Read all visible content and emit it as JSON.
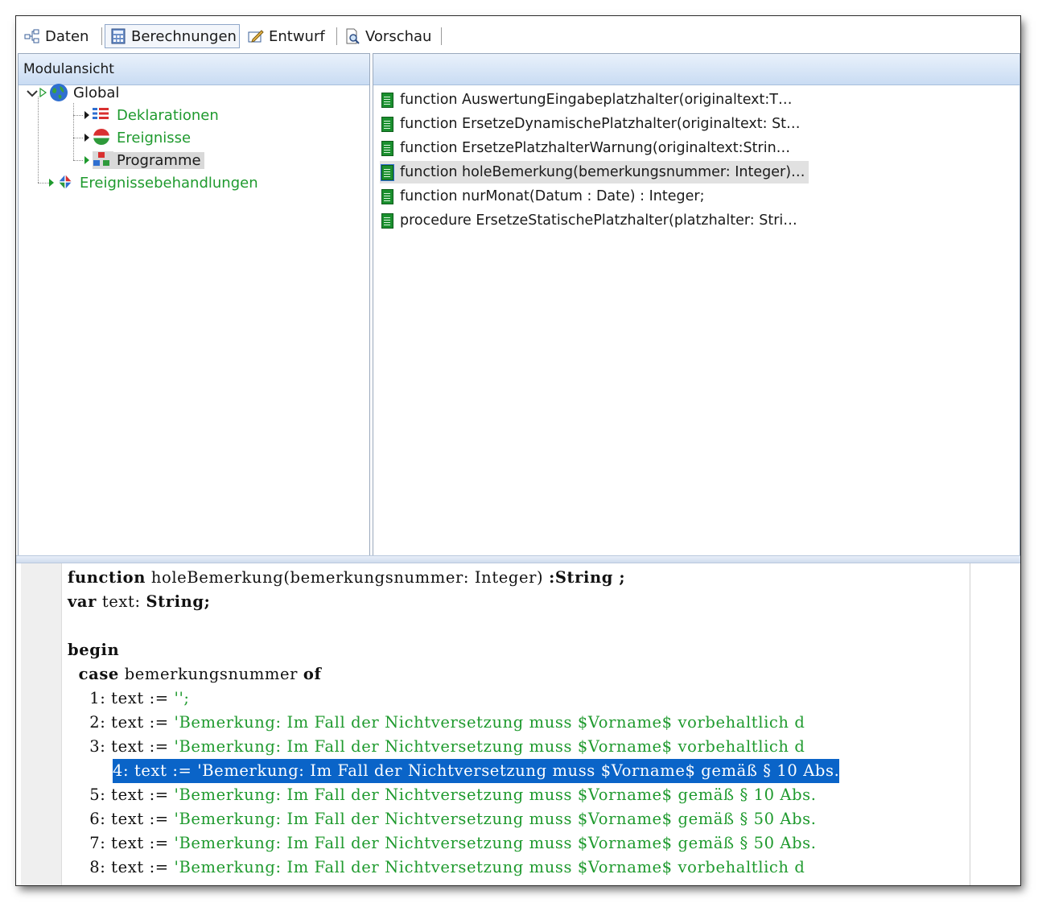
{
  "tabs": [
    {
      "label": "Daten",
      "icon": "data-structure-icon"
    },
    {
      "label": "Berechnungen",
      "icon": "calculator-icon",
      "active": true
    },
    {
      "label": "Entwurf",
      "icon": "edit-pencil-icon"
    },
    {
      "label": "Vorschau",
      "icon": "preview-magnifier-icon"
    }
  ],
  "left_pane": {
    "header": "Modulansicht",
    "tree": {
      "root": {
        "label": "Global",
        "icon": "globe-icon",
        "expanded": true
      },
      "children": [
        {
          "label": "Deklarationen",
          "icon": "declarations-icon"
        },
        {
          "label": "Ereignisse",
          "icon": "events-icon"
        },
        {
          "label": "Programme",
          "icon": "programs-icon",
          "selected": true
        }
      ],
      "sibling": {
        "label": "Ereignissebehandlungen",
        "icon": "event-handlers-icon"
      }
    }
  },
  "right_pane": {
    "header": "",
    "functions": [
      "function AuswertungEingabeplatzhalter(originaltext:T…",
      "function ErsetzeDynamischePlatzhalter(originaltext: St…",
      "function ErsetzePlatzhalterWarnung(originaltext:Strin…",
      "function holeBemerkung(bemerkungsnummer: Integer)…",
      "function nurMonat(Datum : Date) : Integer;",
      "procedure ErsetzeStatischePlatzhalter(platzhalter: Stri…"
    ],
    "selected_index": 3
  },
  "editor": {
    "line1": {
      "kw": "function",
      "rest": " holeBemerkung(bemerkungsnummer: Integer) ",
      "kw2": ":String ;"
    },
    "line2": {
      "kw": "var",
      "rest": " text: ",
      "kw2": "String;"
    },
    "line4": {
      "kw": "begin"
    },
    "line5": {
      "indent": "  ",
      "kw": "case",
      "rest": " bemerkungsnummer ",
      "kw2": "of"
    },
    "case_lines": [
      {
        "prefix": "    1: text := ",
        "str": "'';",
        "highlighted": false
      },
      {
        "prefix": "    2: text := ",
        "str": "'Bemerkung: Im Fall der Nichtversetzung muss $Vorname$ vorbehaltlich d",
        "highlighted": false
      },
      {
        "prefix": "    3: text := ",
        "str": "'Bemerkung: Im Fall der Nichtversetzung muss $Vorname$ vorbehaltlich d",
        "highlighted": false
      },
      {
        "prefix": "    4: text := ",
        "str": "'Bemerkung: Im Fall der Nichtversetzung muss $Vorname$ gemäß § 10 Abs.",
        "highlighted": true
      },
      {
        "prefix": "    5: text := ",
        "str": "'Bemerkung: Im Fall der Nichtversetzung muss $Vorname$ gemäß § 10 Abs.",
        "highlighted": false
      },
      {
        "prefix": "    6: text := ",
        "str": "'Bemerkung: Im Fall der Nichtversetzung muss $Vorname$ gemäß § 50 Abs.",
        "highlighted": false
      },
      {
        "prefix": "    7: text := ",
        "str": "'Bemerkung: Im Fall der Nichtversetzung muss $Vorname$ gemäß § 50 Abs.",
        "highlighted": false
      },
      {
        "prefix": "    8: text := ",
        "str": "'Bemerkung: Im Fall der Nichtversetzung muss $Vorname$ vorbehaltlich d",
        "highlighted": false
      }
    ]
  },
  "colors": {
    "accent": "#0a64c8",
    "tree_green": "#1f9a2e",
    "header_gradient_top": "#e9f1fb",
    "header_gradient_bottom": "#c9dcf3"
  }
}
